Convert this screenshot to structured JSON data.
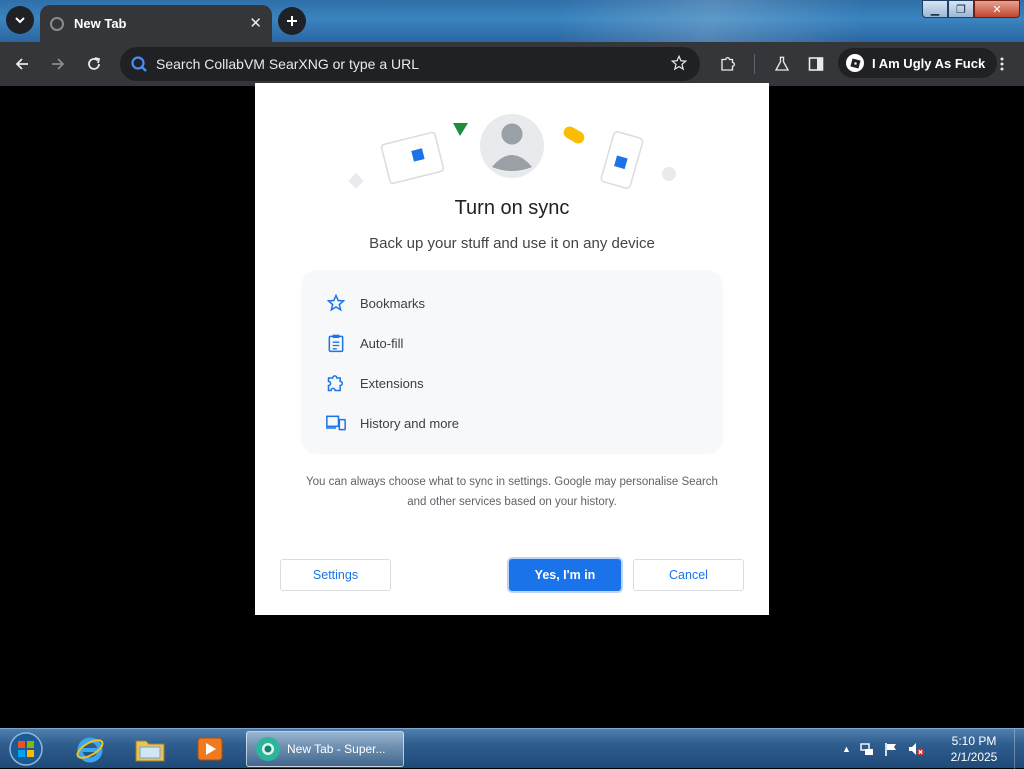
{
  "browser": {
    "tab_title": "New Tab",
    "omnibox_placeholder": "Search CollabVM SearXNG or type a URL",
    "profile_name": "I Am Ugly As Fuck"
  },
  "dialog": {
    "title": "Turn on sync",
    "subtitle": "Back up your stuff and use it on any device",
    "features": [
      {
        "label": "Bookmarks",
        "icon": "star-icon"
      },
      {
        "label": "Auto-fill",
        "icon": "clipboard-icon"
      },
      {
        "label": "Extensions",
        "icon": "puzzle-icon"
      },
      {
        "label": "History and more",
        "icon": "devices-icon"
      }
    ],
    "footnote_line1": "You can always choose what to sync in settings. Google may personalise Search",
    "footnote_line2": "and other services based on your history.",
    "settings_label": "Settings",
    "confirm_label": "Yes, I'm in",
    "cancel_label": "Cancel"
  },
  "taskbar": {
    "active_window_label": "New Tab - Super...",
    "time": "5:10 PM",
    "date": "2/1/2025"
  },
  "colors": {
    "accent": "#1a73e8",
    "chrome_dark": "#35363a",
    "omnibox_bg": "#202124"
  }
}
